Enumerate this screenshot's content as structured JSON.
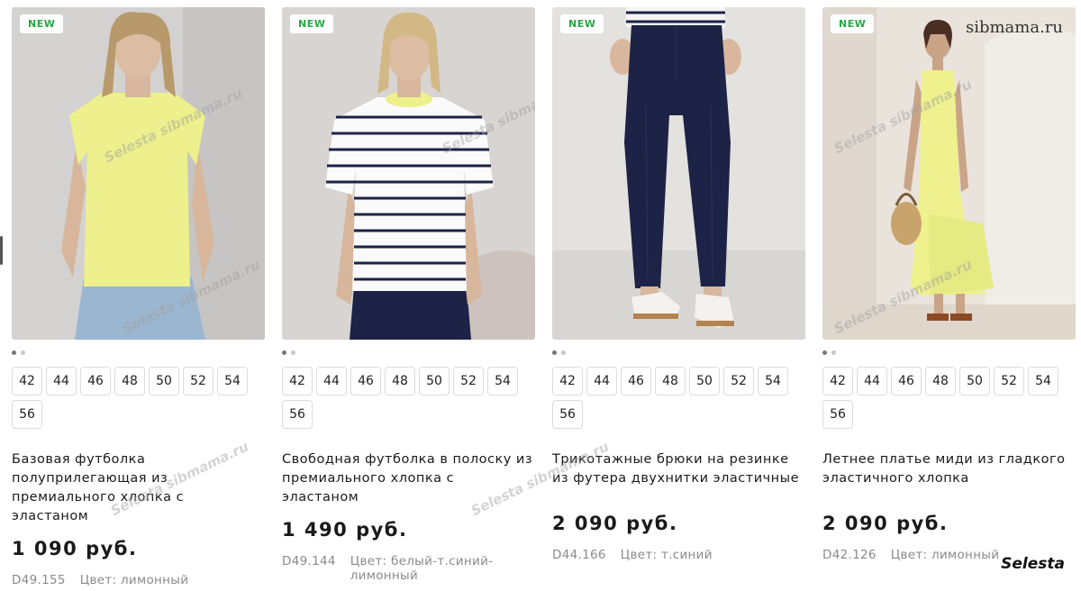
{
  "badge_label": "NEW",
  "watermark_site": "sibmama.ru",
  "watermark_brand": "Selesta",
  "watermark_pattern": "Selesta sibmama.ru",
  "products": [
    {
      "name": "Базовая футболка полуприлегающая из премиального хлопка с эластаном",
      "price": "1 090 руб.",
      "article": "D49.155",
      "color_text": "Цвет: лимонный",
      "sizes": [
        "42",
        "44",
        "46",
        "48",
        "50",
        "52",
        "54",
        "56"
      ],
      "carousel": {
        "count": 2,
        "active": 0
      },
      "garment": "yellow-tshirt"
    },
    {
      "name": "Свободная футболка в полоску из премиального хлопка с эластаном",
      "price": "1 490 руб.",
      "article": "D49.144",
      "color_text": "Цвет: белый-т.синий-лимонный",
      "sizes": [
        "42",
        "44",
        "46",
        "48",
        "50",
        "52",
        "54",
        "56"
      ],
      "carousel": {
        "count": 2,
        "active": 0
      },
      "garment": "striped-tshirt"
    },
    {
      "name": "Трикотажные брюки на резинке из футера двухнитки эластичные",
      "price": "2 090 руб.",
      "article": "D44.166",
      "color_text": "Цвет: т.синий",
      "sizes": [
        "42",
        "44",
        "46",
        "48",
        "50",
        "52",
        "54",
        "56"
      ],
      "carousel": {
        "count": 2,
        "active": 0
      },
      "garment": "navy-trousers"
    },
    {
      "name": "Летнее платье миди из гладкого эластичного хлопка",
      "price": "2 090 руб.",
      "article": "D42.126",
      "color_text": "Цвет: лимонный",
      "sizes": [
        "42",
        "44",
        "46",
        "48",
        "50",
        "52",
        "54",
        "56"
      ],
      "carousel": {
        "count": 2,
        "active": 0
      },
      "garment": "yellow-dress"
    }
  ],
  "colors": {
    "badge_text": "#27a744",
    "lemon": "#eef08a",
    "navy": "#1d2346",
    "text_primary": "#1a1a1a",
    "text_muted": "#8a8a8a",
    "size_border": "#dcdcdc"
  }
}
